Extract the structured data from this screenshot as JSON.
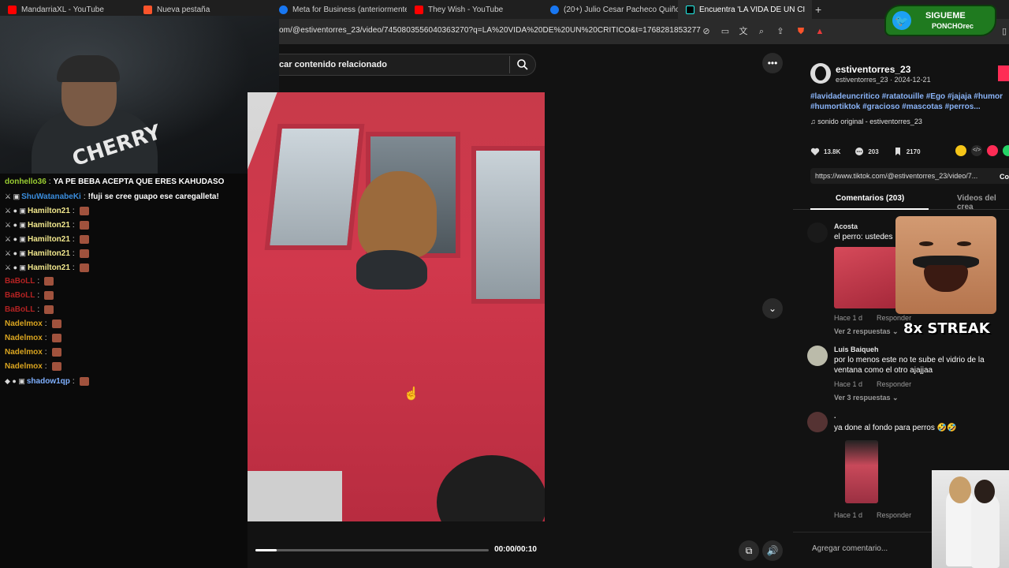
{
  "browser": {
    "tabs": [
      {
        "label": "MandarriaXL - YouTube",
        "color": "#ff0000"
      },
      {
        "label": "Nueva pestaña",
        "color": "#fb542b"
      },
      {
        "label": "Meta for Business (anteriormente, Fa",
        "color": "#1877f2"
      },
      {
        "label": "They Wish - YouTube",
        "color": "#ff0000"
      },
      {
        "label": "(20+) Julio Cesar Pacheco Quiñones",
        "color": "#1877f2"
      },
      {
        "label": "Encuentra 'LA VIDA DE UN CI",
        "color": "#ffffff"
      }
    ],
    "url": "om/@estiventorres_23/video/7450803556040363270?q=LA%20VIDA%20DE%20UN%20CRITICO&t=1768281853277"
  },
  "twitter_overlay": {
    "line1": "SIGUEME",
    "line2": "PONCHOrec"
  },
  "chat": {
    "messages": [
      {
        "user": "donhello36",
        "user_color": "#9acd32",
        "sep": ":",
        "text": "YA PE BEBA ACEPTA QUE ERES KAHUDASO",
        "badges": "",
        "emotes": 0
      },
      {
        "user": "ShuWatanabeKi",
        "user_color": "#3a8dde",
        "sep": ":",
        "text": "!fuji se cree guapo ese caregalleta!",
        "badges": "⚔ ▣",
        "emotes": 0
      },
      {
        "user": "Hamilton21",
        "user_color": "#f0e68c",
        "sep": ":",
        "text": "",
        "badges": "⚔ ● ▣",
        "emotes": 1
      },
      {
        "user": "Hamilton21",
        "user_color": "#f0e68c",
        "sep": ":",
        "text": "",
        "badges": "⚔ ● ▣",
        "emotes": 1
      },
      {
        "user": "Hamilton21",
        "user_color": "#f0e68c",
        "sep": ":",
        "text": "",
        "badges": "⚔ ● ▣",
        "emotes": 1
      },
      {
        "user": "Hamilton21",
        "user_color": "#f0e68c",
        "sep": ":",
        "text": "",
        "badges": "⚔ ● ▣",
        "emotes": 1
      },
      {
        "user": "Hamilton21",
        "user_color": "#f0e68c",
        "sep": ":",
        "text": "",
        "badges": "⚔ ● ▣",
        "emotes": 1
      },
      {
        "user": "BaBoLL",
        "user_color": "#b22222",
        "sep": ":",
        "text": "",
        "badges": "",
        "emotes": 1
      },
      {
        "user": "BaBoLL",
        "user_color": "#b22222",
        "sep": ":",
        "text": "",
        "badges": "",
        "emotes": 1
      },
      {
        "user": "BaBoLL",
        "user_color": "#b22222",
        "sep": ":",
        "text": "",
        "badges": "",
        "emotes": 1
      },
      {
        "user": "Nadelmox",
        "user_color": "#daa520",
        "sep": ":",
        "text": "",
        "badges": "",
        "emotes": 1
      },
      {
        "user": "Nadelmox",
        "user_color": "#daa520",
        "sep": ":",
        "text": "",
        "badges": "",
        "emotes": 1
      },
      {
        "user": "Nadelmox",
        "user_color": "#daa520",
        "sep": ":",
        "text": "",
        "badges": "",
        "emotes": 1
      },
      {
        "user": "Nadelmox",
        "user_color": "#daa520",
        "sep": ":",
        "text": "",
        "badges": "",
        "emotes": 1
      },
      {
        "user": "shadow1qp",
        "user_color": "#7fb0ff",
        "sep": ":",
        "text": "",
        "badges": "◆ ● ▣",
        "emotes": 1
      }
    ]
  },
  "search": {
    "placeholder": "car contenido relacionado"
  },
  "player": {
    "time": "00:00/00:10",
    "progress": 0.09
  },
  "post": {
    "username": "estiventorres_23",
    "subline": "estiventorres_23 · 2024-12-21",
    "hashtags": "#lavidadeuncritico #ratatouille #Ego #jajaja #humor #humortiktok #gracioso #mascotas #perros...",
    "sound": "♫  sonido original - estiventorres_23",
    "likes": "13.8K",
    "comments": "203",
    "saves": "2170",
    "link": "https://www.tiktok.com/@estiventorres_23/video/7...",
    "copy": "Copia",
    "tab_comments": "Comentarios (203)",
    "tab_videos": "Videos del crea"
  },
  "comments": [
    {
      "name": "Acosta",
      "text": "el perro: ustedes",
      "date": "Hace 1 d",
      "reply": "Responder",
      "replies": "Ver 2 respuestas ⌄"
    },
    {
      "name": "Luis Baiqueh",
      "text": "por lo menos este no te sube el vidrio de la ventana como el otro ajajjaa",
      "date": "Hace 1 d",
      "reply": "Responder",
      "replies": "Ver 3 respuestas ⌄"
    },
    {
      "name": ".",
      "text": "ya done al fondo para perros 🤣🤣",
      "date": "Hace 1 d",
      "reply": "Responder",
      "replies": ""
    }
  ],
  "add_comment": {
    "placeholder": "Agregar comentario..."
  },
  "streak_overlay": {
    "label": "8x STREAK"
  }
}
